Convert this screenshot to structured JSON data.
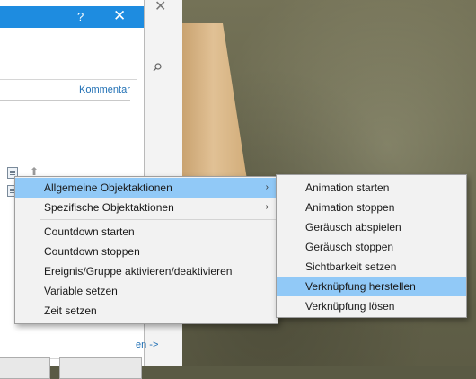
{
  "dialog": {
    "help_label": "?",
    "close_label": "✕",
    "comment_link": "Kommentar",
    "next_link": "en ->"
  },
  "menu": {
    "items": [
      {
        "label": "Allgemeine Objektaktionen",
        "submenu": true,
        "highlighted": true
      },
      {
        "label": "Spezifische Objektaktionen",
        "submenu": true
      },
      {
        "label": "Countdown starten"
      },
      {
        "label": "Countdown stoppen"
      },
      {
        "label": "Ereignis/Gruppe aktivieren/deaktivieren"
      },
      {
        "label": "Variable setzen"
      },
      {
        "label": "Zeit setzen"
      }
    ],
    "submenu_arrow": "›"
  },
  "submenu": {
    "items": [
      {
        "label": "Animation starten"
      },
      {
        "label": "Animation stoppen"
      },
      {
        "label": "Geräusch abspielen"
      },
      {
        "label": "Geräusch stoppen"
      },
      {
        "label": "Sichtbarkeit setzen"
      },
      {
        "label": "Verknüpfung herstellen",
        "highlighted": true
      },
      {
        "label": "Verknüpfung lösen"
      }
    ]
  },
  "colors": {
    "titlebar": "#1e8ce0",
    "highlight": "#91c9f7",
    "link": "#1f6fb4"
  },
  "icons": {
    "search": "search-icon",
    "close": "close-icon",
    "help": "help-icon",
    "action": "action-list-icon",
    "move_up": "arrow-up-icon"
  }
}
